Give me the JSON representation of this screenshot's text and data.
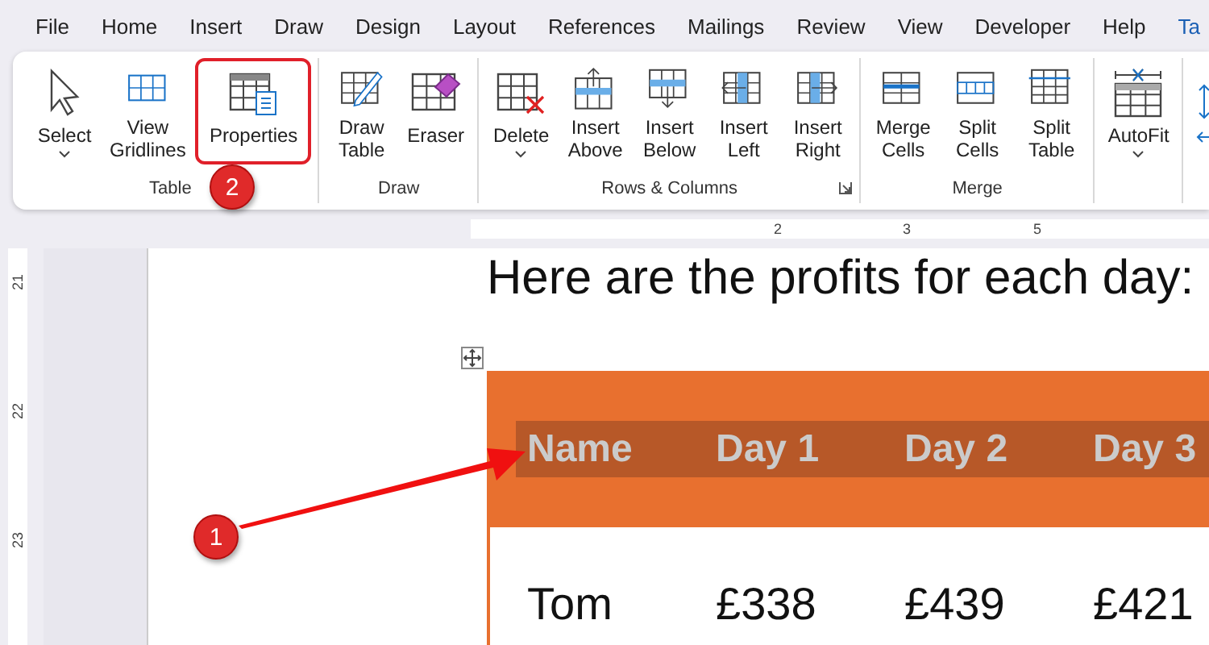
{
  "menu_tabs": [
    {
      "label": "File",
      "selected": false
    },
    {
      "label": "Home",
      "selected": false
    },
    {
      "label": "Insert",
      "selected": false
    },
    {
      "label": "Draw",
      "selected": false
    },
    {
      "label": "Design",
      "selected": false
    },
    {
      "label": "Layout",
      "selected": false
    },
    {
      "label": "References",
      "selected": false
    },
    {
      "label": "Mailings",
      "selected": false
    },
    {
      "label": "Review",
      "selected": false
    },
    {
      "label": "View",
      "selected": false
    },
    {
      "label": "Developer",
      "selected": false
    },
    {
      "label": "Help",
      "selected": false
    },
    {
      "label": "Ta",
      "selected": true
    }
  ],
  "ribbon_groups": [
    {
      "label": "Table",
      "launcher": false,
      "buttons": [
        {
          "kind": "select",
          "label": "Select",
          "dropdown": true,
          "highlighted": false
        },
        {
          "kind": "gridlines",
          "label": "View Gridlines",
          "dropdown": false,
          "highlighted": false
        },
        {
          "kind": "properties",
          "label": "Properties",
          "dropdown": false,
          "highlighted": true
        }
      ]
    },
    {
      "label": "Draw",
      "launcher": false,
      "buttons": [
        {
          "kind": "draw-table",
          "label": "Draw Table",
          "dropdown": false,
          "highlighted": false
        },
        {
          "kind": "eraser",
          "label": "Eraser",
          "dropdown": false,
          "highlighted": false
        }
      ]
    },
    {
      "label": "Rows & Columns",
      "launcher": true,
      "buttons": [
        {
          "kind": "delete",
          "label": "Delete",
          "dropdown": true,
          "highlighted": false
        },
        {
          "kind": "insert-above",
          "label": "Insert Above",
          "dropdown": false,
          "highlighted": false
        },
        {
          "kind": "insert-below",
          "label": "Insert Below",
          "dropdown": false,
          "highlighted": false
        },
        {
          "kind": "insert-left",
          "label": "Insert Left",
          "dropdown": false,
          "highlighted": false
        },
        {
          "kind": "insert-right",
          "label": "Insert Right",
          "dropdown": false,
          "highlighted": false
        }
      ]
    },
    {
      "label": "Merge",
      "launcher": false,
      "buttons": [
        {
          "kind": "merge",
          "label": "Merge Cells",
          "dropdown": false,
          "highlighted": false
        },
        {
          "kind": "split-cells",
          "label": "Split Cells",
          "dropdown": false,
          "highlighted": false
        },
        {
          "kind": "split-table",
          "label": "Split Table",
          "dropdown": false,
          "highlighted": false
        }
      ]
    },
    {
      "launcher": false,
      "buttons": [
        {
          "kind": "autofit",
          "label": "AutoFit",
          "dropdown": true,
          "highlighted": false
        }
      ]
    }
  ],
  "ruler": {
    "numbers": [
      "2",
      "3",
      "5"
    ]
  },
  "vertical_ruler": {
    "numbers": [
      "21",
      "22",
      "23"
    ]
  },
  "document": {
    "heading": "Here are the profits for each day:",
    "table": {
      "header": [
        "Name",
        "Day 1",
        "Day 2",
        "Day 3"
      ],
      "rows": [
        [
          "Tom",
          "£338",
          "£439",
          "£421"
        ]
      ]
    }
  },
  "callouts": [
    {
      "label": "1"
    },
    {
      "label": "2"
    }
  ]
}
